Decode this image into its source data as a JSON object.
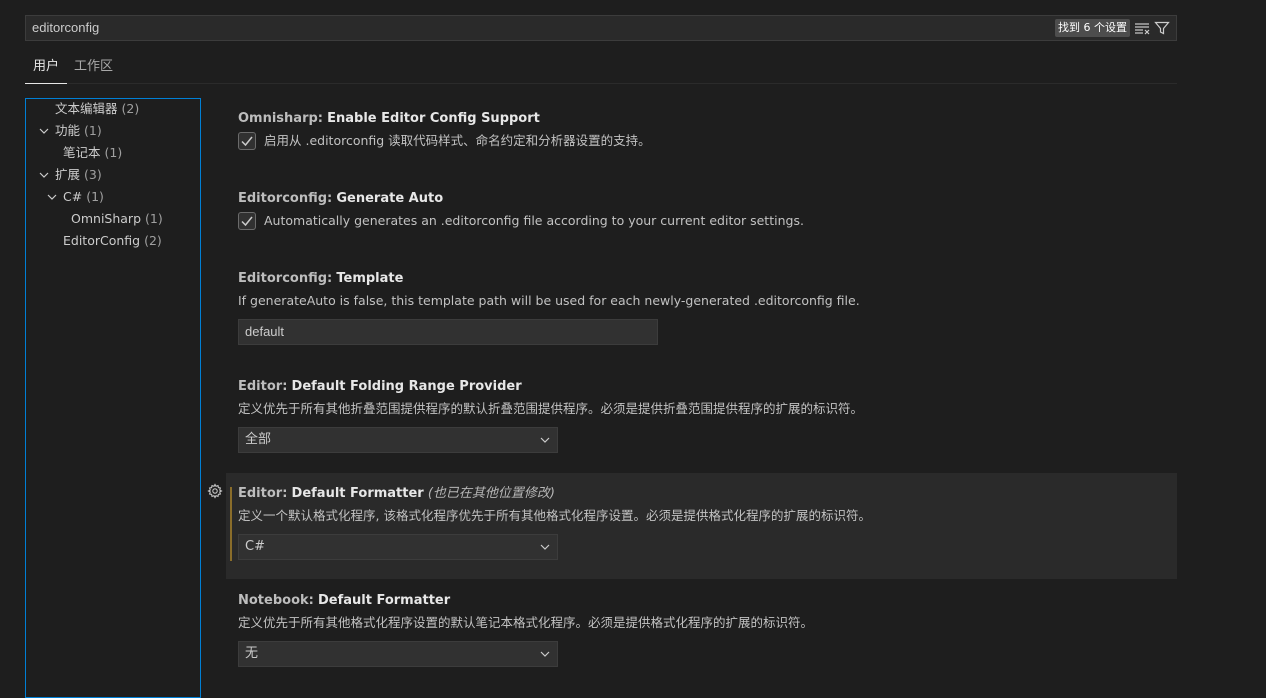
{
  "search": {
    "value": "editorconfig",
    "result_count": "找到 6 个设置",
    "clear_icon": "clear-filter-icon",
    "filter_icon": "filter-icon"
  },
  "tabs": [
    {
      "label": "用户"
    },
    {
      "label": "工作区"
    }
  ],
  "toc": [
    {
      "label": "文本编辑器",
      "count": "(2)"
    },
    {
      "label": "功能",
      "count": "(1)"
    },
    {
      "label": "笔记本",
      "count": "(1)"
    },
    {
      "label": "扩展",
      "count": "(3)"
    },
    {
      "label": "C#",
      "count": "(1)"
    },
    {
      "label": "OmniSharp",
      "count": "(1)"
    },
    {
      "label": "EditorConfig",
      "count": "(2)"
    }
  ],
  "settings": [
    {
      "category": "Omnisharp:",
      "name": "Enable Editor Config Support",
      "checkbox_label": "启用从 .editorconfig 读取代码样式、命名约定和分析器设置的支持。"
    },
    {
      "category": "Editorconfig:",
      "name": "Generate Auto",
      "checkbox_label": "Automatically generates an .editorconfig file according to your current editor settings."
    },
    {
      "category": "Editorconfig:",
      "name": "Template",
      "description": "If generateAuto is false, this template path will be used for each newly-generated .editorconfig file.",
      "value": "default"
    },
    {
      "category": "Editor:",
      "name": "Default Folding Range Provider",
      "description": "定义优先于所有其他折叠范围提供程序的默认折叠范围提供程序。必须是提供折叠范围提供程序的扩展的标识符。",
      "value": "全部"
    },
    {
      "category": "Editor:",
      "name": "Default Formatter",
      "modified_note": "(也已在其他位置修改)",
      "description": "定义一个默认格式化程序, 该格式化程序优先于所有其他格式化程序设置。必须是提供格式化程序的扩展的标识符。",
      "value": "C#"
    },
    {
      "category": "Notebook:",
      "name": "Default Formatter",
      "description": "定义优先于所有其他格式化程序设置的默认笔记本格式化程序。必须是提供格式化程序的扩展的标识符。",
      "value": "无"
    }
  ],
  "colors": {
    "background": "#1e1e1e",
    "focus_border": "#007fd4",
    "modified_indicator": "#8a6d2a"
  }
}
